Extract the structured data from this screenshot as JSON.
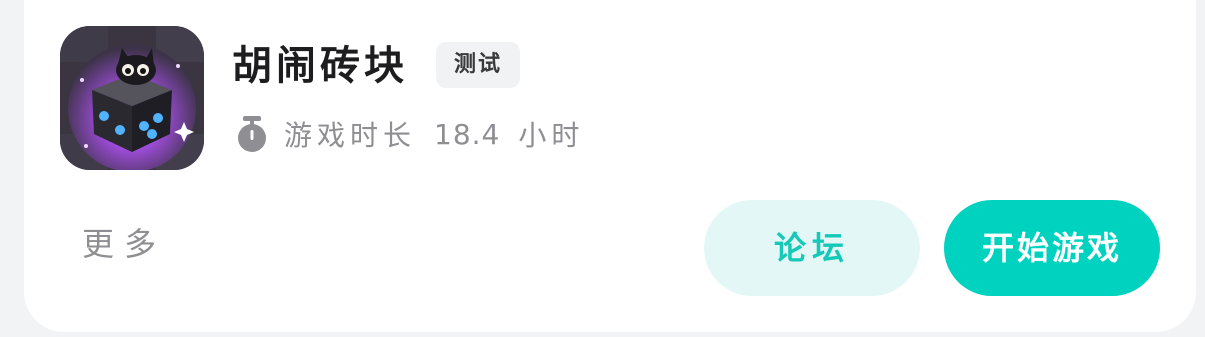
{
  "game": {
    "title": "胡闹砖块",
    "badge": "测试",
    "icon": "cat-dice-app-icon"
  },
  "playtime": {
    "icon": "stopwatch-icon",
    "label": "游戏时长",
    "value": "18.4",
    "unit": "小时"
  },
  "actions": {
    "more_label": "更多",
    "forum_label": "论坛",
    "start_label": "开始游戏"
  },
  "colors": {
    "accent": "#00d2c0",
    "accent_soft": "#e3f8f6",
    "accent_text": "#14c9b8",
    "muted_text": "#8e8e93"
  }
}
